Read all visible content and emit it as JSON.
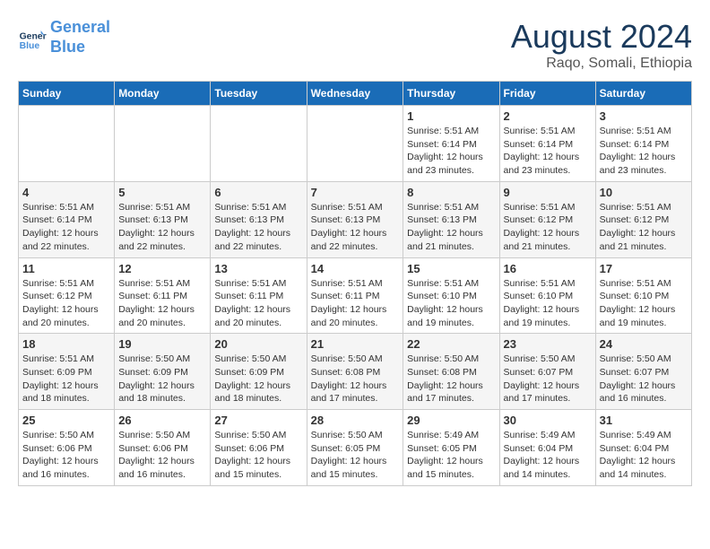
{
  "header": {
    "logo_line1": "General",
    "logo_line2": "Blue",
    "month_title": "August 2024",
    "location": "Raqo, Somali, Ethiopia"
  },
  "weekdays": [
    "Sunday",
    "Monday",
    "Tuesday",
    "Wednesday",
    "Thursday",
    "Friday",
    "Saturday"
  ],
  "weeks": [
    [
      {
        "day": "",
        "info": ""
      },
      {
        "day": "",
        "info": ""
      },
      {
        "day": "",
        "info": ""
      },
      {
        "day": "",
        "info": ""
      },
      {
        "day": "1",
        "info": "Sunrise: 5:51 AM\nSunset: 6:14 PM\nDaylight: 12 hours\nand 23 minutes."
      },
      {
        "day": "2",
        "info": "Sunrise: 5:51 AM\nSunset: 6:14 PM\nDaylight: 12 hours\nand 23 minutes."
      },
      {
        "day": "3",
        "info": "Sunrise: 5:51 AM\nSunset: 6:14 PM\nDaylight: 12 hours\nand 23 minutes."
      }
    ],
    [
      {
        "day": "4",
        "info": "Sunrise: 5:51 AM\nSunset: 6:14 PM\nDaylight: 12 hours\nand 22 minutes."
      },
      {
        "day": "5",
        "info": "Sunrise: 5:51 AM\nSunset: 6:13 PM\nDaylight: 12 hours\nand 22 minutes."
      },
      {
        "day": "6",
        "info": "Sunrise: 5:51 AM\nSunset: 6:13 PM\nDaylight: 12 hours\nand 22 minutes."
      },
      {
        "day": "7",
        "info": "Sunrise: 5:51 AM\nSunset: 6:13 PM\nDaylight: 12 hours\nand 22 minutes."
      },
      {
        "day": "8",
        "info": "Sunrise: 5:51 AM\nSunset: 6:13 PM\nDaylight: 12 hours\nand 21 minutes."
      },
      {
        "day": "9",
        "info": "Sunrise: 5:51 AM\nSunset: 6:12 PM\nDaylight: 12 hours\nand 21 minutes."
      },
      {
        "day": "10",
        "info": "Sunrise: 5:51 AM\nSunset: 6:12 PM\nDaylight: 12 hours\nand 21 minutes."
      }
    ],
    [
      {
        "day": "11",
        "info": "Sunrise: 5:51 AM\nSunset: 6:12 PM\nDaylight: 12 hours\nand 20 minutes."
      },
      {
        "day": "12",
        "info": "Sunrise: 5:51 AM\nSunset: 6:11 PM\nDaylight: 12 hours\nand 20 minutes."
      },
      {
        "day": "13",
        "info": "Sunrise: 5:51 AM\nSunset: 6:11 PM\nDaylight: 12 hours\nand 20 minutes."
      },
      {
        "day": "14",
        "info": "Sunrise: 5:51 AM\nSunset: 6:11 PM\nDaylight: 12 hours\nand 20 minutes."
      },
      {
        "day": "15",
        "info": "Sunrise: 5:51 AM\nSunset: 6:10 PM\nDaylight: 12 hours\nand 19 minutes."
      },
      {
        "day": "16",
        "info": "Sunrise: 5:51 AM\nSunset: 6:10 PM\nDaylight: 12 hours\nand 19 minutes."
      },
      {
        "day": "17",
        "info": "Sunrise: 5:51 AM\nSunset: 6:10 PM\nDaylight: 12 hours\nand 19 minutes."
      }
    ],
    [
      {
        "day": "18",
        "info": "Sunrise: 5:51 AM\nSunset: 6:09 PM\nDaylight: 12 hours\nand 18 minutes."
      },
      {
        "day": "19",
        "info": "Sunrise: 5:50 AM\nSunset: 6:09 PM\nDaylight: 12 hours\nand 18 minutes."
      },
      {
        "day": "20",
        "info": "Sunrise: 5:50 AM\nSunset: 6:09 PM\nDaylight: 12 hours\nand 18 minutes."
      },
      {
        "day": "21",
        "info": "Sunrise: 5:50 AM\nSunset: 6:08 PM\nDaylight: 12 hours\nand 17 minutes."
      },
      {
        "day": "22",
        "info": "Sunrise: 5:50 AM\nSunset: 6:08 PM\nDaylight: 12 hours\nand 17 minutes."
      },
      {
        "day": "23",
        "info": "Sunrise: 5:50 AM\nSunset: 6:07 PM\nDaylight: 12 hours\nand 17 minutes."
      },
      {
        "day": "24",
        "info": "Sunrise: 5:50 AM\nSunset: 6:07 PM\nDaylight: 12 hours\nand 16 minutes."
      }
    ],
    [
      {
        "day": "25",
        "info": "Sunrise: 5:50 AM\nSunset: 6:06 PM\nDaylight: 12 hours\nand 16 minutes."
      },
      {
        "day": "26",
        "info": "Sunrise: 5:50 AM\nSunset: 6:06 PM\nDaylight: 12 hours\nand 16 minutes."
      },
      {
        "day": "27",
        "info": "Sunrise: 5:50 AM\nSunset: 6:06 PM\nDaylight: 12 hours\nand 15 minutes."
      },
      {
        "day": "28",
        "info": "Sunrise: 5:50 AM\nSunset: 6:05 PM\nDaylight: 12 hours\nand 15 minutes."
      },
      {
        "day": "29",
        "info": "Sunrise: 5:49 AM\nSunset: 6:05 PM\nDaylight: 12 hours\nand 15 minutes."
      },
      {
        "day": "30",
        "info": "Sunrise: 5:49 AM\nSunset: 6:04 PM\nDaylight: 12 hours\nand 14 minutes."
      },
      {
        "day": "31",
        "info": "Sunrise: 5:49 AM\nSunset: 6:04 PM\nDaylight: 12 hours\nand 14 minutes."
      }
    ]
  ]
}
